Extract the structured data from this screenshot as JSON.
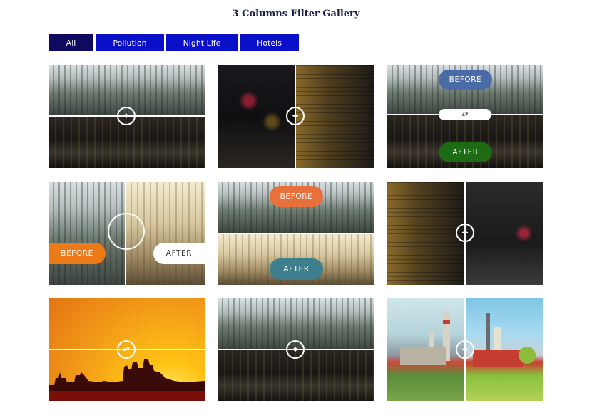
{
  "page": {
    "title": "3 Columns Filter Gallery"
  },
  "filters": [
    {
      "label": "All",
      "active": true
    },
    {
      "label": "Pollution",
      "active": false
    },
    {
      "label": "Night Life",
      "active": false
    },
    {
      "label": "Hotels",
      "active": false
    }
  ],
  "labels": {
    "before": "BEFORE",
    "after": "AFTER"
  },
  "colors": {
    "filter_active": "#0e0b5e",
    "filter_default": "#0a10c7",
    "pill_blue": "#4a6aa8",
    "pill_green": "#1d6b12",
    "pill_orange": "#ec7a18",
    "pill_white": "#ffffff",
    "pill_salmon": "#e8703c",
    "pill_teal": "#3d7f8d"
  },
  "gallery": {
    "comparison_positions": [
      0.5,
      0.5,
      0.5,
      0.5,
      0.5,
      0.5,
      0.5,
      0.5,
      0.5
    ]
  }
}
